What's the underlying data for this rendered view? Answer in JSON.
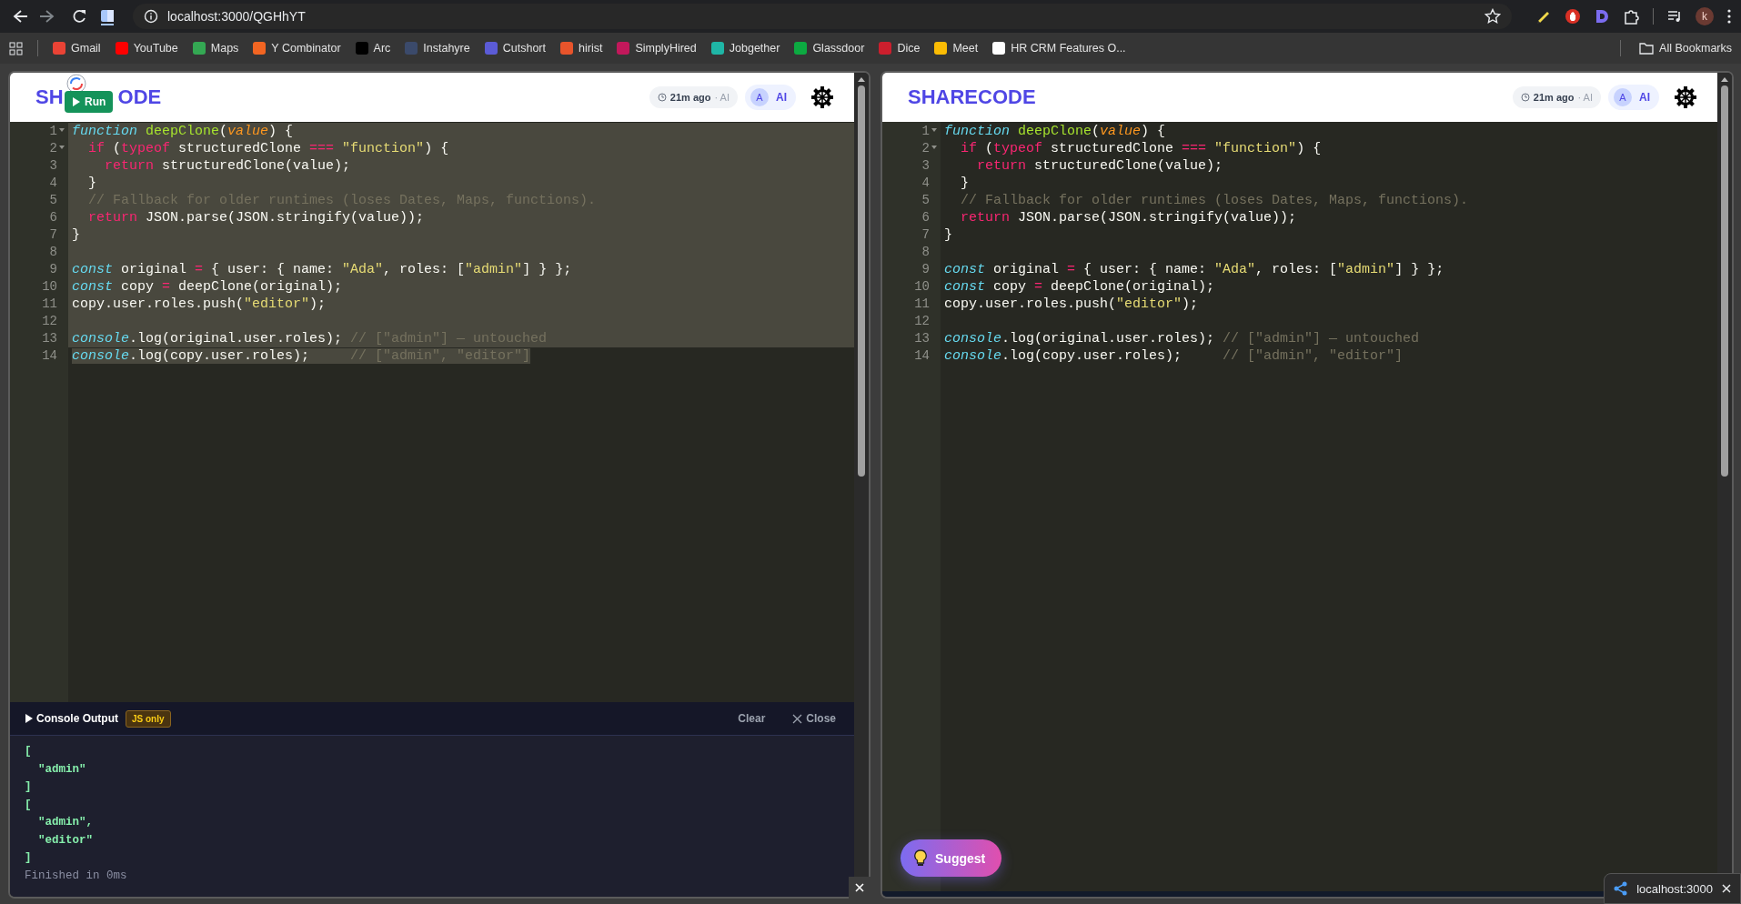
{
  "browser": {
    "url": "localhost:3000/QGHhYT",
    "profile_initial": "k",
    "all_bookmarks": "All Bookmarks",
    "bookmarks": [
      {
        "label": "Gmail",
        "color": "#ea4335"
      },
      {
        "label": "YouTube",
        "color": "#ff0000"
      },
      {
        "label": "Maps",
        "color": "#34a853"
      },
      {
        "label": "Y Combinator",
        "color": "#f26522"
      },
      {
        "label": "Arc",
        "color": "#000000"
      },
      {
        "label": "Instahyre",
        "color": "#3b4a6b"
      },
      {
        "label": "Cutshort",
        "color": "#5b5bd6"
      },
      {
        "label": "hirist",
        "color": "#e8542b"
      },
      {
        "label": "SimplyHired",
        "color": "#c2185b"
      },
      {
        "label": "Jobgether",
        "color": "#1fb6a6"
      },
      {
        "label": "Glassdoor",
        "color": "#0caa41"
      },
      {
        "label": "Dice",
        "color": "#cc1f2d"
      },
      {
        "label": "Meet",
        "color": "#fbbc04"
      },
      {
        "label": "HR CRM Features O...",
        "color": "#ffffff"
      }
    ]
  },
  "panes": [
    {
      "logo": [
        "SH",
        "ODE"
      ],
      "run_button": {
        "label": "Run"
      },
      "time": "21m ago",
      "time_suffix": "· AI",
      "avatar": "A",
      "ai_label": "AI",
      "code": [
        {
          "number": "1",
          "fold": true,
          "selected": true,
          "tokens": [
            {
              "kind": "kw",
              "text": "function"
            },
            {
              "kind": "fn",
              "text": " deepClone"
            },
            {
              "kind": "plain",
              "text": "("
            },
            {
              "kind": "param",
              "text": "value"
            },
            {
              "kind": "plain",
              "text": ") {"
            }
          ]
        },
        {
          "number": "2",
          "fold": true,
          "selected": true,
          "tokens": [
            {
              "kind": "op",
              "text": "  if"
            },
            {
              "kind": "plain",
              "text": " ("
            },
            {
              "kind": "op",
              "text": "typeof"
            },
            {
              "kind": "plain",
              "text": " structuredClone "
            },
            {
              "kind": "op",
              "text": "==="
            },
            {
              "kind": "str",
              "text": " \"function\""
            },
            {
              "kind": "plain",
              "text": ") {"
            }
          ]
        },
        {
          "number": "3",
          "fold": false,
          "selected": true,
          "tokens": [
            {
              "kind": "op",
              "text": "    return"
            },
            {
              "kind": "plain",
              "text": " structuredClone(value);"
            }
          ]
        },
        {
          "number": "4",
          "fold": false,
          "selected": true,
          "tokens": [
            {
              "kind": "plain",
              "text": "  }"
            }
          ]
        },
        {
          "number": "5",
          "fold": false,
          "selected": true,
          "tokens": [
            {
              "kind": "cm",
              "text": "  // Fallback for older runtimes (loses Dates, Maps, functions)."
            }
          ]
        },
        {
          "number": "6",
          "fold": false,
          "selected": true,
          "tokens": [
            {
              "kind": "op",
              "text": "  return"
            },
            {
              "kind": "plain",
              "text": " JSON.parse(JSON.stringify(value));"
            }
          ]
        },
        {
          "number": "7",
          "fold": false,
          "selected": true,
          "tokens": [
            {
              "kind": "plain",
              "text": "}"
            }
          ]
        },
        {
          "number": "8",
          "fold": false,
          "selected": true
        },
        {
          "number": "9",
          "fold": false,
          "selected": true,
          "tokens": [
            {
              "kind": "kw",
              "text": "const"
            },
            {
              "kind": "plain",
              "text": " original "
            },
            {
              "kind": "op",
              "text": "="
            },
            {
              "kind": "plain",
              "text": " { user: { name: "
            },
            {
              "kind": "str",
              "text": "\"Ada\""
            },
            {
              "kind": "plain",
              "text": ", roles: ["
            },
            {
              "kind": "str",
              "text": "\"admin\""
            },
            {
              "kind": "plain",
              "text": "] } };"
            }
          ]
        },
        {
          "number": "10",
          "fold": false,
          "selected": true,
          "tokens": [
            {
              "kind": "kw",
              "text": "const"
            },
            {
              "kind": "plain",
              "text": " copy "
            },
            {
              "kind": "op",
              "text": "="
            },
            {
              "kind": "plain",
              "text": " deepClone(original);"
            }
          ]
        },
        {
          "number": "11",
          "fold": false,
          "selected": true,
          "tokens": [
            {
              "kind": "plain",
              "text": "copy.user.roles.push("
            },
            {
              "kind": "str",
              "text": "\"editor\""
            },
            {
              "kind": "plain",
              "text": ");"
            }
          ]
        },
        {
          "number": "12",
          "fold": false,
          "selected": true
        },
        {
          "number": "13",
          "fold": false,
          "selected": true,
          "tokens": [
            {
              "kind": "kw",
              "text": "console"
            },
            {
              "kind": "plain",
              "text": ".log(original.user.roles); "
            },
            {
              "kind": "cm",
              "text": "// [\"admin\"] — untouched"
            }
          ]
        },
        {
          "number": "14",
          "fold": false,
          "selected": true,
          "tokens": [
            {
              "kind": "kw",
              "text": "console"
            },
            {
              "kind": "plain",
              "text": ".log(copy.user.roles);     "
            },
            {
              "kind": "cm",
              "text": "// [\"admin\", \"editor\"]"
            }
          ]
        }
      ],
      "console": {
        "title": "Console Output",
        "badge": "JS only",
        "clear": "Clear",
        "close": "Close",
        "output": [
          "[",
          "  \"admin\"",
          "]",
          "[",
          "  \"admin\",",
          "  \"editor\"",
          "]"
        ],
        "status": "Finished in 0ms"
      }
    },
    {
      "logo": [
        "SHARECODE"
      ],
      "time": "21m ago",
      "time_suffix": "· AI",
      "avatar": "A",
      "ai_label": "AI",
      "code": [
        {
          "number": "1",
          "fold": true,
          "selected": false,
          "tokens": [
            {
              "kind": "kw",
              "text": "function"
            },
            {
              "kind": "fn",
              "text": " deepClone"
            },
            {
              "kind": "plain",
              "text": "("
            },
            {
              "kind": "param",
              "text": "value"
            },
            {
              "kind": "plain",
              "text": ") {"
            }
          ]
        },
        {
          "number": "2",
          "fold": true,
          "selected": false,
          "tokens": [
            {
              "kind": "op",
              "text": "  if"
            },
            {
              "kind": "plain",
              "text": " ("
            },
            {
              "kind": "op",
              "text": "typeof"
            },
            {
              "kind": "plain",
              "text": " structuredClone "
            },
            {
              "kind": "op",
              "text": "==="
            },
            {
              "kind": "str",
              "text": " \"function\""
            },
            {
              "kind": "plain",
              "text": ") {"
            }
          ]
        },
        {
          "number": "3",
          "fold": false,
          "selected": false,
          "tokens": [
            {
              "kind": "op",
              "text": "    return"
            },
            {
              "kind": "plain",
              "text": " structuredClone(value);"
            }
          ]
        },
        {
          "number": "4",
          "fold": false,
          "selected": false,
          "tokens": [
            {
              "kind": "plain",
              "text": "  }"
            }
          ]
        },
        {
          "number": "5",
          "fold": false,
          "selected": false,
          "tokens": [
            {
              "kind": "cm",
              "text": "  // Fallback for older runtimes (loses Dates, Maps, functions)."
            }
          ]
        },
        {
          "number": "6",
          "fold": false,
          "selected": false,
          "tokens": [
            {
              "kind": "op",
              "text": "  return"
            },
            {
              "kind": "plain",
              "text": " JSON.parse(JSON.stringify(value));"
            }
          ]
        },
        {
          "number": "7",
          "fold": false,
          "selected": false,
          "tokens": [
            {
              "kind": "plain",
              "text": "}"
            }
          ]
        },
        {
          "number": "8",
          "fold": false,
          "selected": false
        },
        {
          "number": "9",
          "fold": false,
          "selected": false,
          "tokens": [
            {
              "kind": "kw",
              "text": "const"
            },
            {
              "kind": "plain",
              "text": " original "
            },
            {
              "kind": "op",
              "text": "="
            },
            {
              "kind": "plain",
              "text": " { user: { name: "
            },
            {
              "kind": "str",
              "text": "\"Ada\""
            },
            {
              "kind": "plain",
              "text": ", roles: ["
            },
            {
              "kind": "str",
              "text": "\"admin\""
            },
            {
              "kind": "plain",
              "text": "] } };"
            }
          ]
        },
        {
          "number": "10",
          "fold": false,
          "selected": false,
          "tokens": [
            {
              "kind": "kw",
              "text": "const"
            },
            {
              "kind": "plain",
              "text": " copy "
            },
            {
              "kind": "op",
              "text": "="
            },
            {
              "kind": "plain",
              "text": " deepClone(original);"
            }
          ]
        },
        {
          "number": "11",
          "fold": false,
          "selected": false,
          "tokens": [
            {
              "kind": "plain",
              "text": "copy.user.roles.push("
            },
            {
              "kind": "str",
              "text": "\"editor\""
            },
            {
              "kind": "plain",
              "text": ");"
            }
          ]
        },
        {
          "number": "12",
          "fold": false,
          "selected": false
        },
        {
          "number": "13",
          "fold": false,
          "selected": false,
          "tokens": [
            {
              "kind": "kw",
              "text": "console"
            },
            {
              "kind": "plain",
              "text": ".log(original.user.roles); "
            },
            {
              "kind": "cm",
              "text": "// [\"admin\"] — untouched"
            }
          ]
        },
        {
          "number": "14",
          "fold": false,
          "selected": false,
          "tokens": [
            {
              "kind": "kw",
              "text": "console"
            },
            {
              "kind": "plain",
              "text": ".log(copy.user.roles);     "
            },
            {
              "kind": "cm",
              "text": "// [\"admin\", \"editor\"]"
            }
          ]
        }
      ],
      "suggest_button": {
        "label": "Suggest"
      }
    }
  ],
  "toast": {
    "label": "localhost:3000"
  }
}
